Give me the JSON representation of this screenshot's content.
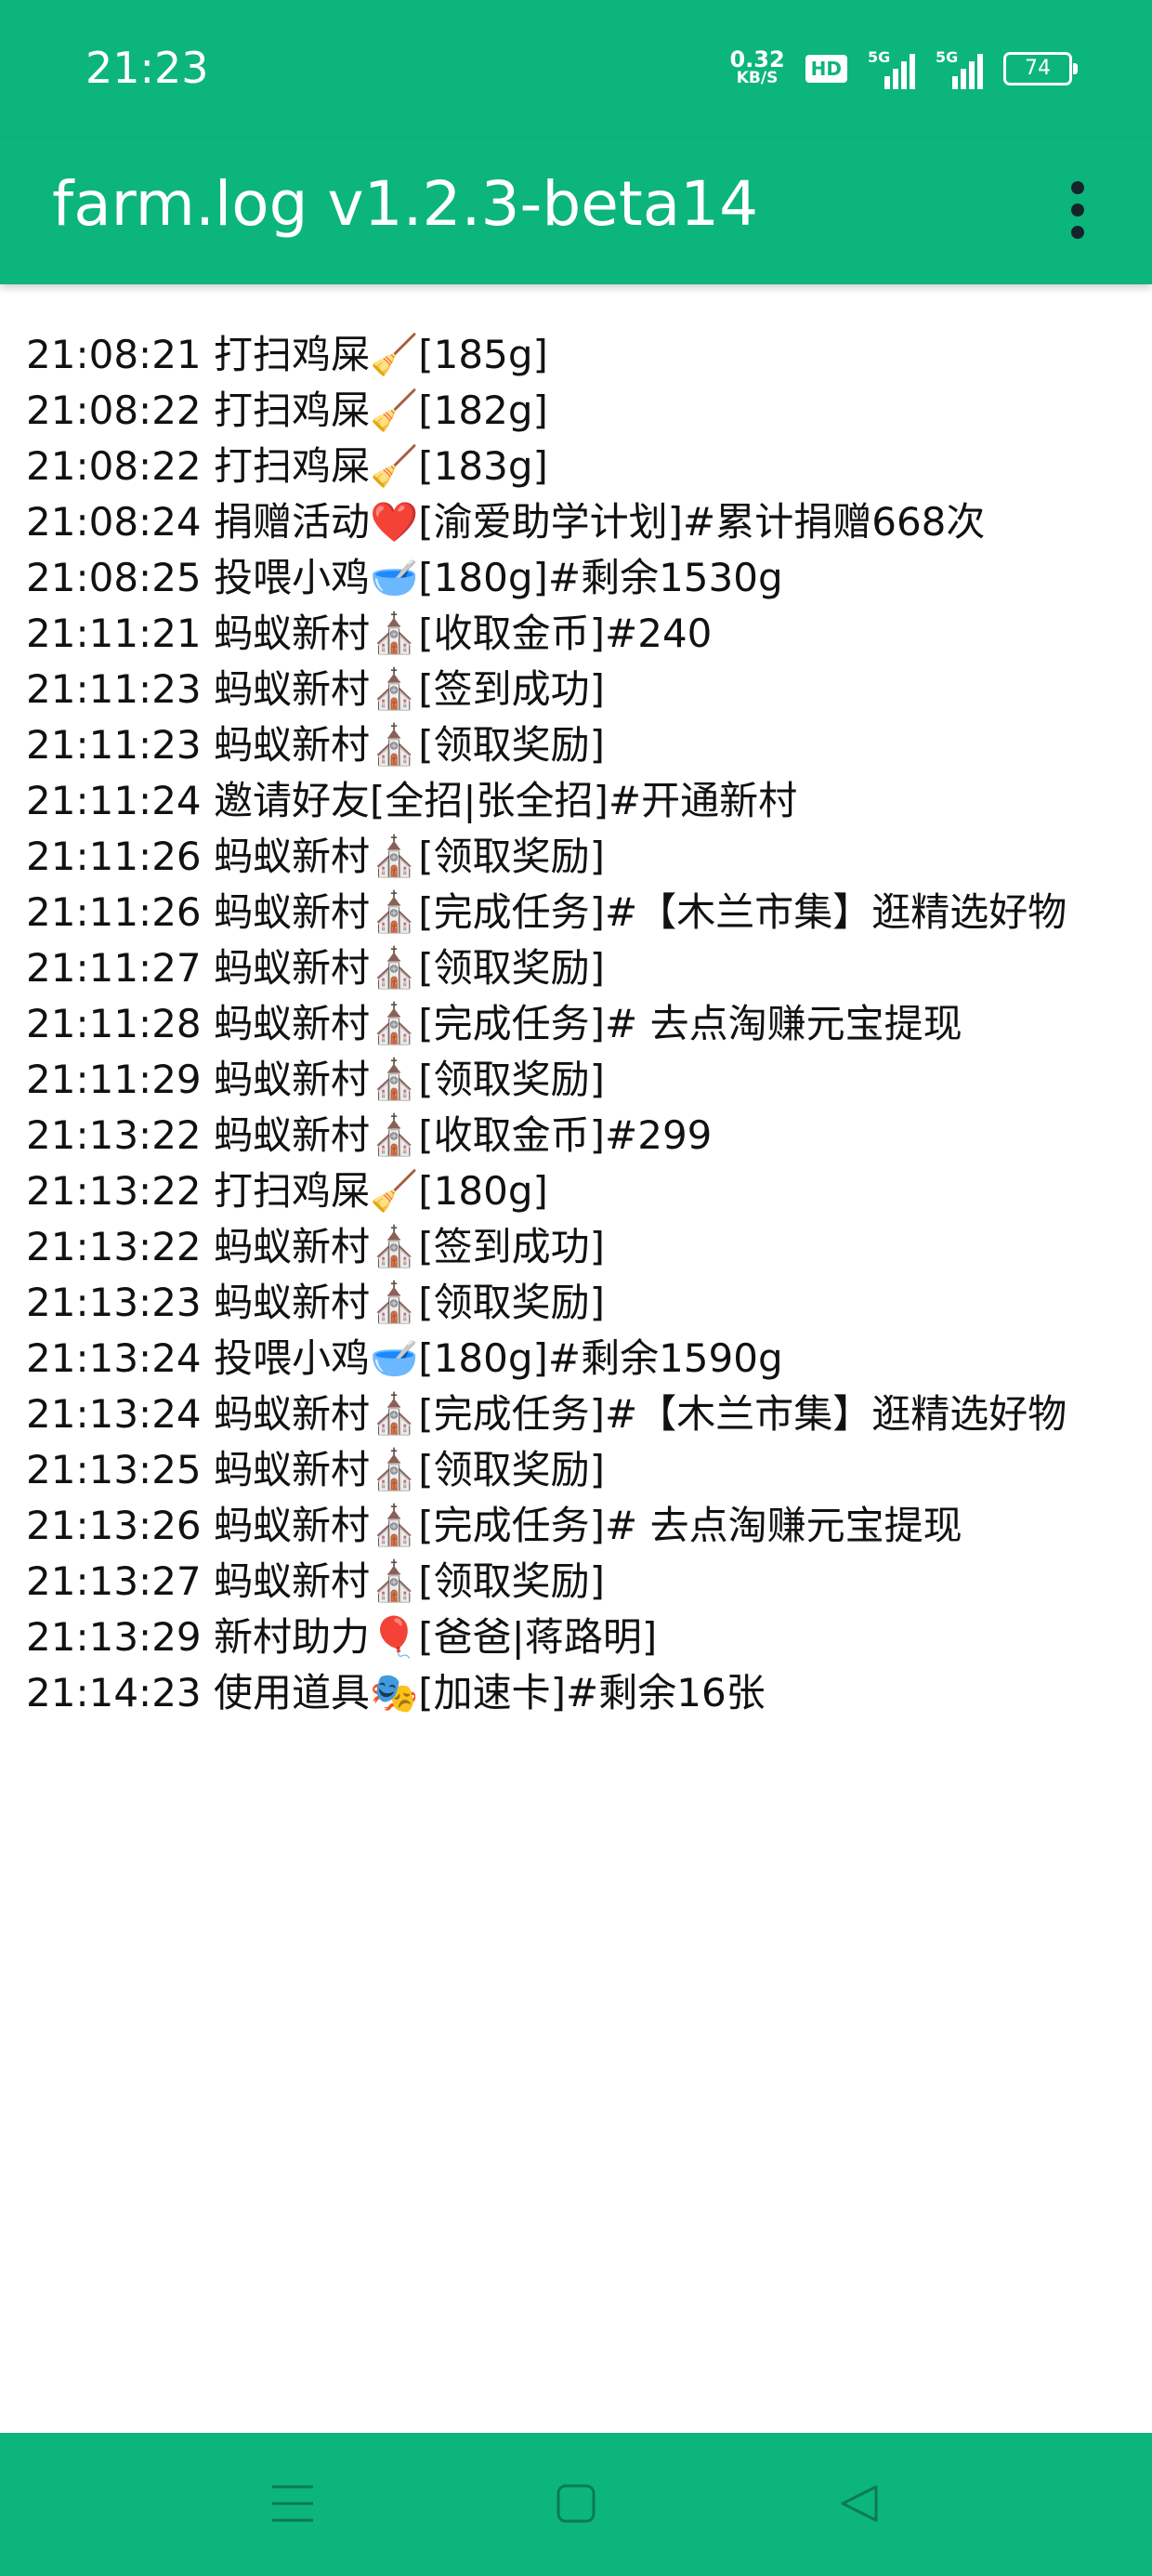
{
  "status_bar": {
    "time": "21:23",
    "net_speed_value": "0.32",
    "net_speed_unit": "KB/S",
    "hd_label": "HD",
    "signal1_label": "5G",
    "signal2_label": "5G",
    "battery": "74"
  },
  "app_bar": {
    "title": "farm.log v1.2.3-beta14",
    "menu_icon": "more-vert-icon"
  },
  "log": {
    "lines": [
      "21:08:21 打扫鸡屎🧹[185g]",
      "21:08:22 打扫鸡屎🧹[182g]",
      "21:08:22 打扫鸡屎🧹[183g]",
      "21:08:24 捐赠活动❤️[渝爱助学计划]#累计捐赠668次",
      "21:08:25 投喂小鸡🥣[180g]#剩余1530g",
      "21:11:21 蚂蚁新村⛪[收取金币]#240",
      "21:11:23 蚂蚁新村⛪[签到成功]",
      "21:11:23 蚂蚁新村⛪[领取奖励]",
      "21:11:24 邀请好友[全招|张全招]#开通新村",
      "21:11:26 蚂蚁新村⛪[领取奖励]",
      "21:11:26 蚂蚁新村⛪[完成任务]#【木兰市集】逛精选好物",
      "21:11:27 蚂蚁新村⛪[领取奖励]",
      "21:11:28 蚂蚁新村⛪[完成任务]# 去点淘赚元宝提现",
      "21:11:29 蚂蚁新村⛪[领取奖励]",
      "21:13:22 蚂蚁新村⛪[收取金币]#299",
      "21:13:22 打扫鸡屎🧹[180g]",
      "21:13:22 蚂蚁新村⛪[签到成功]",
      "21:13:23 蚂蚁新村⛪[领取奖励]",
      "21:13:24 投喂小鸡🥣[180g]#剩余1590g",
      "21:13:24 蚂蚁新村⛪[完成任务]#【木兰市集】逛精选好物",
      "21:13:25 蚂蚁新村⛪[领取奖励]",
      "21:13:26 蚂蚁新村⛪[完成任务]# 去点淘赚元宝提现",
      "21:13:27 蚂蚁新村⛪[领取奖励]",
      "21:13:29 新村助力🎈[爸爸|蒋路明]",
      "21:14:23 使用道具🎭[加速卡]#剩余16张"
    ]
  },
  "nav_bar": {
    "menu_icon": "menu-lines-icon",
    "home_icon": "home-square-icon",
    "back_icon": "back-triangle-icon"
  },
  "colors": {
    "accent": "#0cb57b",
    "text": "#111111",
    "background": "#ffffff"
  }
}
